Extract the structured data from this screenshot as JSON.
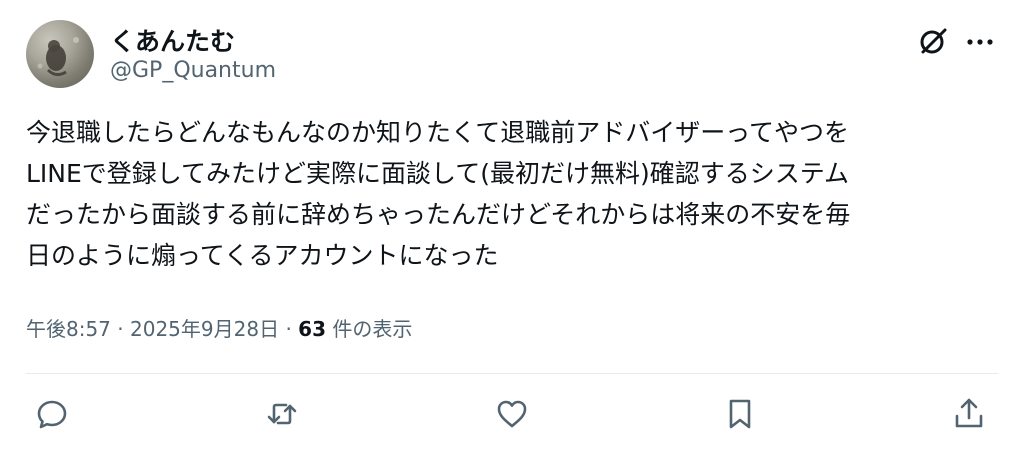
{
  "user": {
    "display_name": "くあんたむ",
    "handle": "@GP_Quantum",
    "avatar": "avatar-photo"
  },
  "tweet": {
    "lines": [
      "今退職したらどんなもんなのか知りたくて退職前アドバイザーってやつを",
      "LINEで登録してみたけど実際に面談して(最初だけ無料)確認するシステム",
      "だったから面談する前に辞めちゃったんだけどそれからは将来の不安を毎",
      "日のように煽ってくるアカウントになった"
    ]
  },
  "meta": {
    "time": "午後8:57",
    "sep1": "·",
    "date": "2025年9月28日",
    "sep2": "·",
    "views_count": "63",
    "views_label": "件の表示"
  },
  "header_icons": [
    "grok-icon",
    "more-icon"
  ],
  "actions": [
    "reply-icon",
    "retweet-icon",
    "like-icon",
    "bookmark-icon",
    "share-icon"
  ],
  "colors": {
    "text": "#0f1419",
    "secondary": "#536471",
    "divider": "#e6ecf0",
    "icon": "#536471"
  }
}
